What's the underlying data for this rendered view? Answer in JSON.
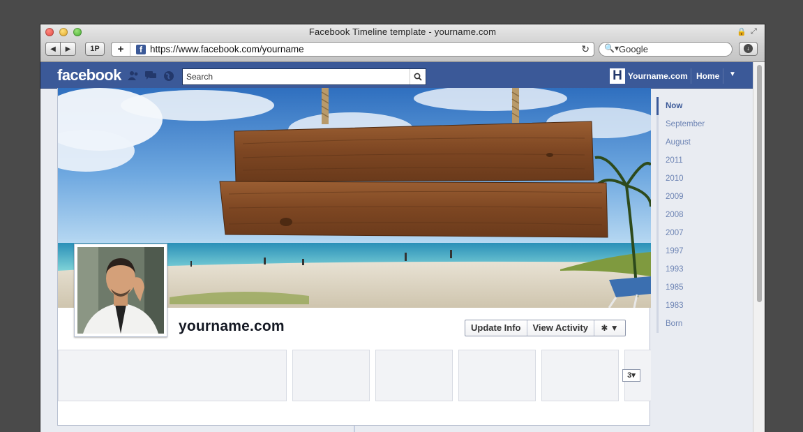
{
  "window": {
    "title": "Facebook Timeline template - yourname.com",
    "back_label": "◀",
    "forward_label": "▶",
    "onepassword_label": "1P",
    "add_label": "+",
    "url": "https://www.facebook.com/yourname",
    "search_placeholder": "Google"
  },
  "fb": {
    "logo": "facebook",
    "search_placeholder": "Search",
    "user_initial": "H",
    "user_name": "Yourname.com",
    "home_label": "Home"
  },
  "profile": {
    "name": "yourname.com",
    "update_info_label": "Update Info",
    "view_activity_label": "View Activity",
    "count_badge": "3"
  },
  "scrubber": {
    "items": [
      "Now",
      "September",
      "August",
      "2011",
      "2010",
      "2009",
      "2008",
      "2007",
      "1997",
      "1993",
      "1985",
      "1983",
      "Born"
    ]
  },
  "colors": {
    "fb_blue": "#3b5998",
    "fb_dark_blue": "#29447e",
    "scrub_link": "#6d84b4"
  }
}
